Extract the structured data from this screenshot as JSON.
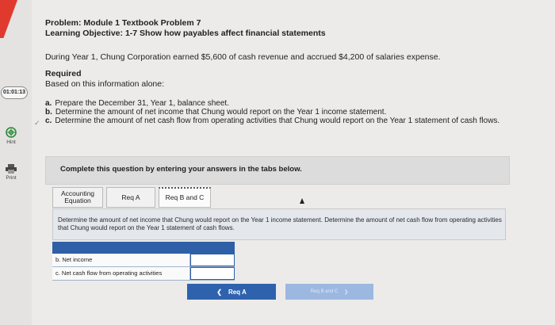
{
  "sidebar": {
    "timer": "01:01:13",
    "hint_label": "Hint",
    "print_label": "Print"
  },
  "problem": {
    "title": "Problem: Module 1 Textbook Problem 7",
    "objective": "Learning Objective: 1-7 Show how payables affect financial statements",
    "intro": "During Year 1, Chung Corporation earned $5,600 of cash revenue and accrued $4,200 of salaries expense.",
    "required_heading": "Required",
    "required_sub": "Based on this information alone:",
    "tasks": [
      {
        "letter": "a.",
        "text": "Prepare the December 31, Year 1, balance sheet."
      },
      {
        "letter": "b.",
        "text": "Determine the amount of net income that Chung would report on the Year 1 income statement."
      },
      {
        "letter": "c.",
        "text": "Determine the amount of net cash flow from operating activities that Chung would report on the Year 1 statement of cash flows."
      }
    ]
  },
  "complete_instruction": "Complete this question by entering your answers in the tabs below.",
  "tabs": [
    {
      "label": "Accounting Equation",
      "active": false
    },
    {
      "label": "Req A",
      "active": false
    },
    {
      "label": "Req B and C",
      "active": true
    }
  ],
  "panel_text": "Determine the amount of net income that Chung would report on the Year 1 income statement. Determine the amount of net cash flow from operating activities that Chung would report on the Year 1 statement of cash flows.",
  "answer_table": {
    "rows": [
      {
        "label": "b. Net income",
        "value": ""
      },
      {
        "label": "c. Net cash flow from operating activities",
        "value": ""
      }
    ]
  },
  "nav": {
    "prev_label": "Req A",
    "next_label": "Req B and C"
  },
  "colors": {
    "accent_blue": "#2f62ad",
    "brand_red": "#e03a2e"
  }
}
